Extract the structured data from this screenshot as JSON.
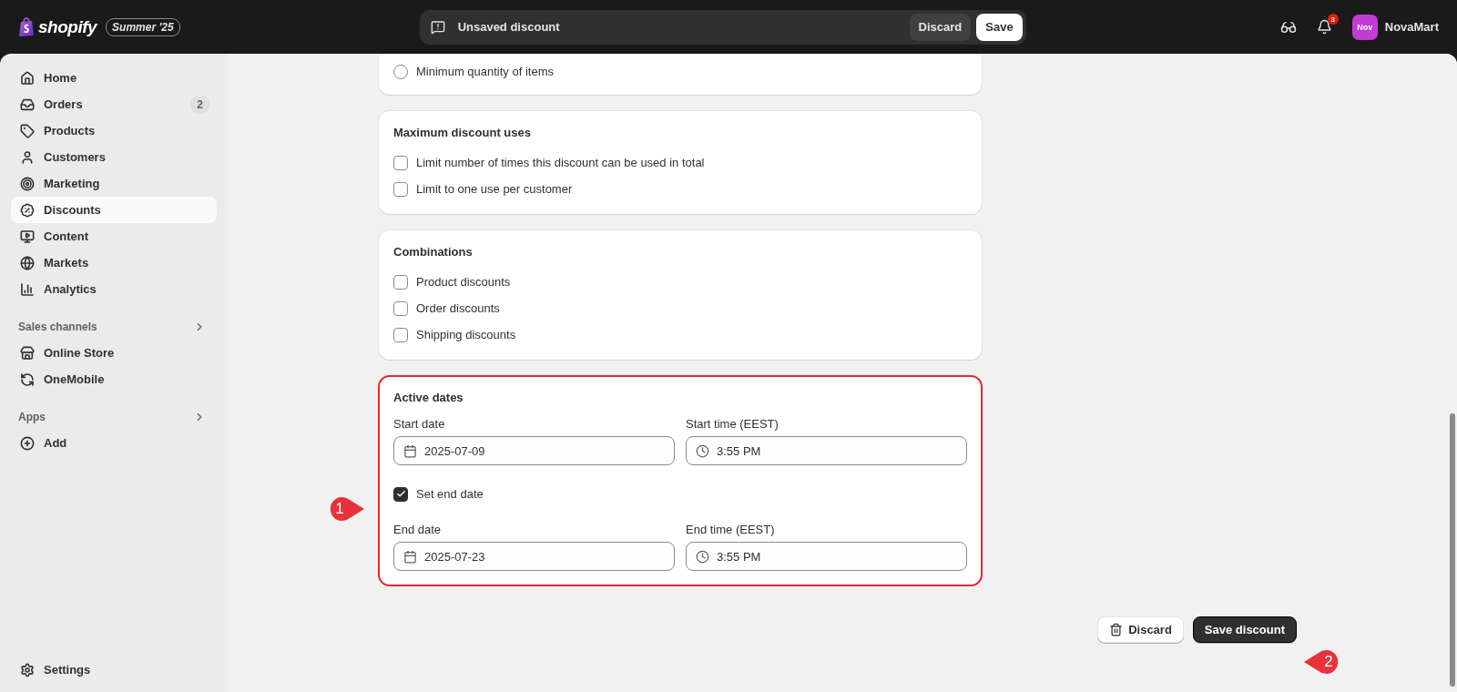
{
  "topbar": {
    "brand": "shopify",
    "edition": "Summer '25",
    "save_bar": {
      "message": "Unsaved discount",
      "buttons": [
        {
          "label": "Discard",
          "kind": "secondary"
        },
        {
          "label": "Save",
          "kind": "primary"
        }
      ]
    },
    "notifications": {
      "count": "3"
    },
    "account": {
      "initials": "Nov",
      "name": "NovaMart"
    }
  },
  "sidebar": {
    "items": [
      {
        "label": "Home",
        "selected": false
      },
      {
        "label": "Orders",
        "selected": false,
        "badge": "2"
      },
      {
        "label": "Products",
        "selected": false
      },
      {
        "label": "Customers",
        "selected": false
      },
      {
        "label": "Marketing",
        "selected": false
      },
      {
        "label": "Discounts",
        "selected": true
      },
      {
        "label": "Content",
        "selected": false
      },
      {
        "label": "Markets",
        "selected": false
      },
      {
        "label": "Analytics",
        "selected": false
      }
    ],
    "sections": [
      {
        "title": "Sales channels",
        "items": [
          {
            "label": "Online Store",
            "selected": false
          },
          {
            "label": "OneMobile",
            "selected": false
          }
        ]
      },
      {
        "title": "Apps",
        "items": [
          {
            "label": "Add",
            "selected": false
          }
        ]
      }
    ],
    "footer": {
      "label": "Settings",
      "selected": false
    }
  },
  "cards": [
    {
      "kind": "options",
      "cut_top": true,
      "options": [
        {
          "kind": "radio",
          "label": "Minimum quantity of items",
          "selected": false
        }
      ]
    },
    {
      "kind": "options",
      "title": "Maximum discount uses",
      "options": [
        {
          "kind": "checkbox",
          "label": "Limit number of times this discount can be used in total",
          "checked": false
        },
        {
          "kind": "checkbox",
          "label": "Limit to one use per customer",
          "checked": false
        }
      ]
    },
    {
      "kind": "options",
      "title": "Combinations",
      "options": [
        {
          "kind": "checkbox",
          "label": "Product discounts",
          "checked": false
        },
        {
          "kind": "checkbox",
          "label": "Order discounts",
          "checked": false
        },
        {
          "kind": "checkbox",
          "label": "Shipping discounts",
          "checked": false
        }
      ]
    },
    {
      "kind": "dates",
      "title": "Active dates",
      "highlighted": true,
      "start": [
        {
          "kind": "date",
          "label": "Start date",
          "value": "2025-07-09"
        },
        {
          "kind": "time",
          "label": "Start time (EEST)",
          "value": "3:55 PM"
        }
      ],
      "end_toggle": {
        "label": "Set end date",
        "checked": true
      },
      "end": [
        {
          "kind": "date",
          "label": "End date",
          "value": "2025-07-23"
        },
        {
          "kind": "time",
          "label": "End time (EEST)",
          "value": "3:55 PM"
        }
      ]
    }
  ],
  "actions": [
    {
      "kind": "secondary",
      "label": "Discard"
    },
    {
      "kind": "primary",
      "label": "Save discount"
    }
  ],
  "callouts": [
    {
      "label": "1"
    },
    {
      "label": "2"
    }
  ]
}
